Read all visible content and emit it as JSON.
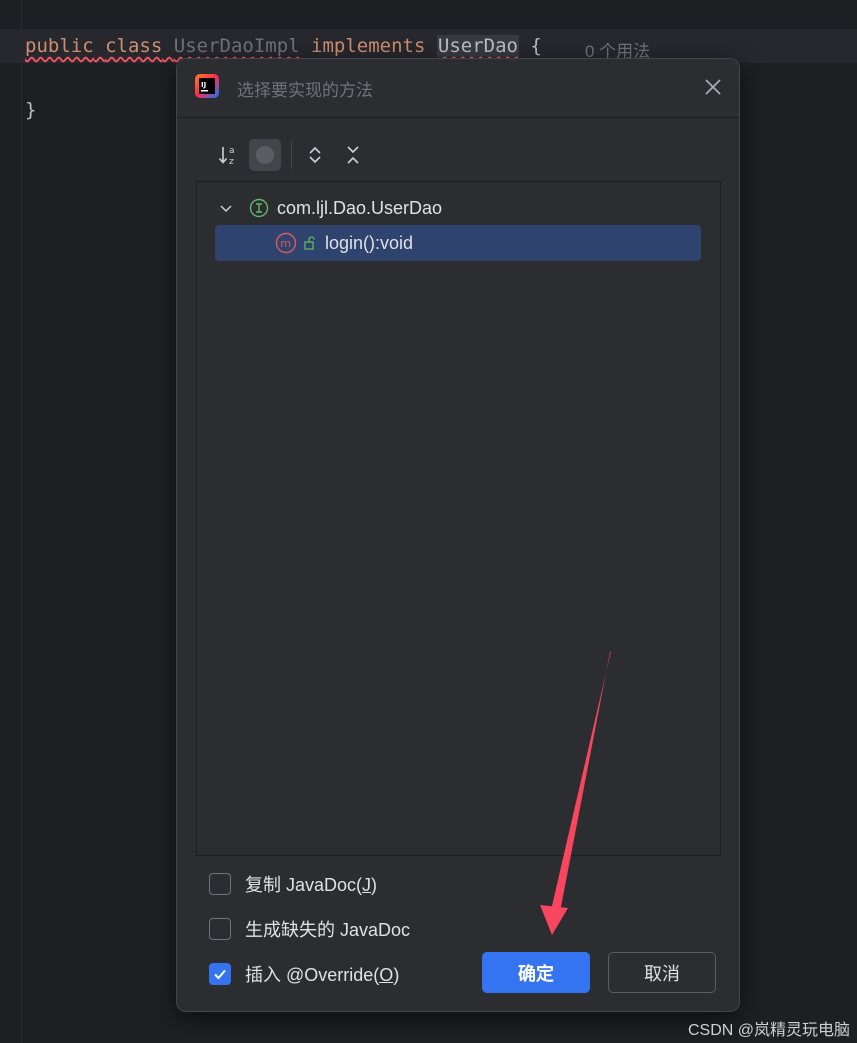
{
  "editor": {
    "code_line": {
      "kw_public": "public",
      "kw_class": "class",
      "class_name": "UserDaoImpl",
      "kw_implements": "implements",
      "interface_name": "UserDao",
      "open_brace": "{"
    },
    "usages_hint": "0 个用法",
    "close_brace": "}"
  },
  "dialog": {
    "app_icon": "intellij-idea-icon",
    "title": "选择要实现的方法",
    "toolbar": {
      "sort_icon": "sort-alphabetically-icon",
      "group_icon": "show-classes-icon",
      "expand_icon": "expand-all-icon",
      "collapse_icon": "collapse-all-icon"
    },
    "tree": {
      "nodes": [
        {
          "label": "com.ljl.Dao.UserDao",
          "icon": "interface-icon",
          "expanded": true
        },
        {
          "label": "login():void",
          "icon": "method-icon",
          "selected": true
        }
      ]
    },
    "options": [
      {
        "label": "复制 JavaDoc(",
        "mnemonic": "J",
        "suffix": ")",
        "checked": false
      },
      {
        "label": "生成缺失的 JavaDoc",
        "checked": false
      },
      {
        "label": "插入 @Override(",
        "mnemonic": "O",
        "suffix": ")",
        "checked": true
      }
    ],
    "ok_label": "确定",
    "cancel_label": "取消"
  },
  "colors": {
    "accent": "#3574f0",
    "selection": "#2e436e",
    "keyword": "#cf8e6d",
    "annotation_arrow": "#f7465e"
  },
  "watermark": "CSDN @岚精灵玩电脑"
}
